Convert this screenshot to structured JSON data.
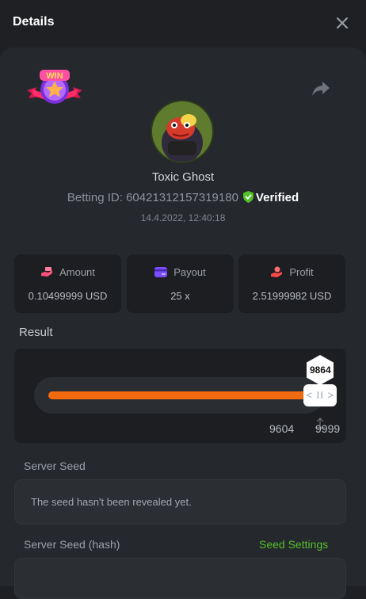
{
  "header": {
    "title": "Details"
  },
  "bet": {
    "username": "Toxic Ghost",
    "betting_id_label": "Betting ID:",
    "betting_id": "60421312157319180",
    "verified_label": "Verified",
    "timestamp": "14.4.2022, 12:40:18"
  },
  "stats": [
    {
      "label": "Amount",
      "value": "0.10499999 USD",
      "icon": "money-hand-icon"
    },
    {
      "label": "Payout",
      "value": "25 x",
      "icon": "card-icon"
    },
    {
      "label": "Profit",
      "value": "2.51999982 USD",
      "icon": "profit-hand-icon"
    }
  ],
  "result": {
    "label": "Result",
    "value": "9864",
    "min_label": "9604",
    "max_label": "9999",
    "scale_min": 0,
    "scale_max": 9999,
    "slider_handle_text": "< II >"
  },
  "server_seed": {
    "label": "Server Seed",
    "text": "The seed hasn't been revealed yet."
  },
  "server_seed_hash": {
    "label": "Server Seed (hash)",
    "settings_link": "Seed Settings"
  },
  "colors": {
    "accent_orange": "#f26a0f",
    "verified_green": "#53c12c",
    "amount_icon": "#ff4f7b",
    "payout_icon": "#7b4dff",
    "profit_icon": "#ff4848"
  },
  "badges": {
    "win_badge_text": "WIN"
  }
}
